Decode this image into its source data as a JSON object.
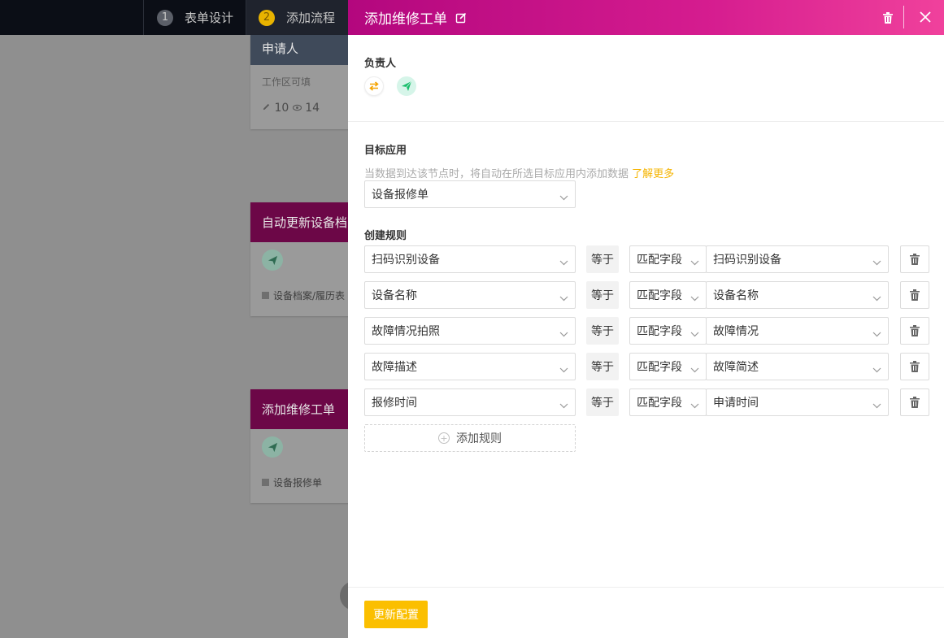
{
  "topnav": {
    "steps": [
      {
        "num": "1",
        "label": "表单设计"
      },
      {
        "num": "2",
        "label": "添加流程"
      }
    ]
  },
  "canvas": {
    "applicant_card": {
      "title": "申请人",
      "sub": "工作区可填",
      "edit_count": "10",
      "view_count": "14"
    },
    "update_card": {
      "title": "自动更新设备档",
      "footer": "设备档案/履历表"
    },
    "add_card": {
      "title": "添加维修工单",
      "footer": "设备报修单"
    }
  },
  "drawer": {
    "title": "添加维修工单",
    "owner_label": "负责人",
    "target_label": "目标应用",
    "target_hint": "当数据到达该节点时，将自动在所选目标应用内添加数据",
    "learn_more": "了解更多",
    "target_app": "设备报修单",
    "rules_label": "创建规则",
    "rules": [
      {
        "field": "扫码识别设备",
        "op": "等于",
        "mode": "匹配字段",
        "value": "扫码识别设备"
      },
      {
        "field": "设备名称",
        "op": "等于",
        "mode": "匹配字段",
        "value": "设备名称"
      },
      {
        "field": "故障情况拍照",
        "op": "等于",
        "mode": "匹配字段",
        "value": "故障情况"
      },
      {
        "field": "故障描述",
        "op": "等于",
        "mode": "匹配字段",
        "value": "故障简述"
      },
      {
        "field": "报修时间",
        "op": "等于",
        "mode": "匹配字段",
        "value": "申请时间"
      }
    ],
    "add_rule": "添加规则",
    "update_button": "更新配置"
  },
  "colors": {
    "accent": "#fbbf00",
    "header_gradient_start": "#b3077e",
    "header_gradient_end": "#f0419c",
    "plane_green": "#19be6b"
  }
}
